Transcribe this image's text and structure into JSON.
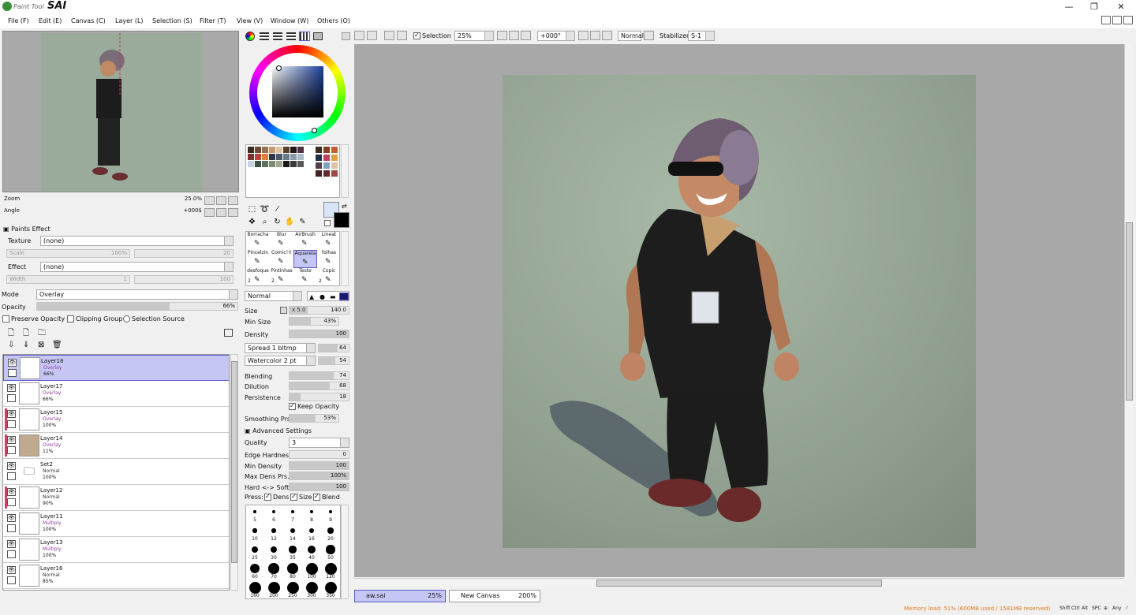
{
  "app": {
    "logo_small": "Paint Tool",
    "logo_big": "SAI"
  },
  "window_controls": {
    "minimize": "—",
    "restore": "❐",
    "close": "✕"
  },
  "menu": [
    "File (F)",
    "Edit (E)",
    "Canvas (C)",
    "Layer (L)",
    "Selection (S)",
    "Filter (T)",
    "View (V)",
    "Window (W)",
    "Others (O)"
  ],
  "navigator": {
    "zoom_label": "Zoom",
    "zoom_value": "25.0%",
    "angle_label": "Angle",
    "angle_value": "+000$"
  },
  "paints_effect": {
    "header": "Paints Effect",
    "texture_label": "Texture",
    "texture_value": "(none)",
    "scale_label": "Scale",
    "scale_value": "100%",
    "scale_num": "20",
    "effect_label": "Effect",
    "effect_value": "(none)",
    "width_label": "Width",
    "width_value": "1",
    "width_num": "100"
  },
  "layer_props": {
    "mode_label": "Mode",
    "mode_value": "Overlay",
    "opacity_label": "Opacity",
    "opacity_value": "66%",
    "opacity_fraction": 0.66,
    "preserve_opacity": "Preserve Opacity",
    "clipping_group": "Clipping Group",
    "selection_source": "Selection Source"
  },
  "layers": [
    {
      "name": "Layer18",
      "mode": "Overlay",
      "opacity": "66%",
      "selected": true,
      "clip": false,
      "thumb": "#ffffff"
    },
    {
      "name": "Layer17",
      "mode": "Overlay",
      "opacity": "66%",
      "selected": false,
      "clip": false,
      "thumb": "#ffffff"
    },
    {
      "name": "Layer15",
      "mode": "Overlay",
      "opacity": "100%",
      "selected": false,
      "clip": true,
      "thumb": "#ffffff"
    },
    {
      "name": "Layer14",
      "mode": "Overlay",
      "opacity": "11%",
      "selected": false,
      "clip": true,
      "thumb": "#bfa98f"
    },
    {
      "name": "Set2",
      "mode": "Normal",
      "opacity": "100%",
      "selected": false,
      "clip": false,
      "thumb": "folder"
    },
    {
      "name": "Layer12",
      "mode": "Normal",
      "opacity": "90%",
      "selected": false,
      "clip": true,
      "thumb": "#ffffff"
    },
    {
      "name": "Layer11",
      "mode": "Multiply",
      "opacity": "100%",
      "selected": false,
      "clip": false,
      "thumb": "#ffffff"
    },
    {
      "name": "Layer13",
      "mode": "Multiply",
      "opacity": "100%",
      "selected": false,
      "clip": false,
      "thumb": "#ffffff"
    },
    {
      "name": "Layer16",
      "mode": "Normal",
      "opacity": "85%",
      "selected": false,
      "clip": false,
      "thumb": "#ffffff"
    }
  ],
  "brushes": [
    {
      "name": "Borracha",
      "num": "",
      "sel": false
    },
    {
      "name": "Blur",
      "num": "",
      "sel": false
    },
    {
      "name": "AirBrush",
      "num": "",
      "sel": false
    },
    {
      "name": "Lineat",
      "num": "",
      "sel": false
    },
    {
      "name": "Pincelzin",
      "num": "",
      "sel": false
    },
    {
      "name": "Comic!!!",
      "num": "",
      "sel": false
    },
    {
      "name": "Aquarela",
      "num": "",
      "sel": true
    },
    {
      "name": "folhas",
      "num": "",
      "sel": false
    },
    {
      "name": "desfoque",
      "num": "2",
      "sel": false
    },
    {
      "name": "Pintinhas",
      "num": "2",
      "sel": false
    },
    {
      "name": "Teste",
      "num": "",
      "sel": false
    },
    {
      "name": "Copic",
      "num": "2",
      "sel": false
    }
  ],
  "brush_settings": {
    "blend_mode": "Normal",
    "size_label": "Size",
    "size_mult": "x 5.0",
    "size_value": "140.0",
    "min_size_label": "Min Size",
    "min_size_value": "43%",
    "density_label": "Density",
    "density_value": "100",
    "spread_label": "Spread 1 bltmp",
    "spread_value": "64",
    "watercolor_label": "Watercolor 2 pt",
    "watercolor_value": "54",
    "blending_label": "Blending",
    "blending_value": "74",
    "dilution_label": "Dilution",
    "dilution_value": "68",
    "persistence_label": "Persistence",
    "persistence_value": "18",
    "keep_opacity": "Keep Opacity",
    "smoothing_label": "Smoothing Prs",
    "smoothing_value": "53%",
    "advanced": "Advanced Settings",
    "quality_label": "Quality",
    "quality_value": "3",
    "edge_label": "Edge Hardness",
    "edge_value": "0",
    "min_density_label": "Min Density",
    "min_density_value": "100",
    "max_dens_label": "Max Dens Prs.",
    "max_dens_value": "100%",
    "hard_soft_label": "Hard <-> Soft",
    "hard_soft_value": "100",
    "press_label": "Press:",
    "press_dens": "Dens",
    "press_size": "Size",
    "press_blend": "Blend"
  },
  "brush_sizes": [
    "5",
    "6",
    "7",
    "8",
    "9",
    "10",
    "12",
    "14",
    "16",
    "20",
    "25",
    "30",
    "35",
    "40",
    "50",
    "60",
    "70",
    "80",
    "100",
    "120",
    "160",
    "200",
    "250",
    "300",
    "350"
  ],
  "canvas_toolbar": {
    "selection": "Selection",
    "zoom": "25%",
    "angle": "+000°",
    "blend": "Normal",
    "stabilizer_label": "Stabilizer",
    "stabilizer_value": "S-1"
  },
  "tabs": [
    {
      "name": "aw.sai",
      "zoom": "25%",
      "active": true
    },
    {
      "name": "New Canvas",
      "zoom": "200%",
      "active": false
    }
  ],
  "status": {
    "memory": "Memory load: 51% (600MB used / 1581MB reserved)",
    "keys": [
      "Shift",
      "Ctrl",
      "Alt",
      "SPC",
      "⊕",
      "Any",
      "⁄"
    ]
  },
  "colors": {
    "accent_sel": "#c6c6f5",
    "clip": "#d04060",
    "memory": "#e07b20"
  }
}
